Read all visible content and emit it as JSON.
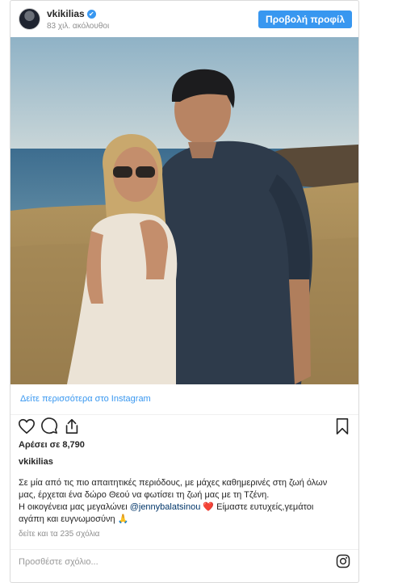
{
  "post": {
    "username": "vkikilias",
    "verified_mark": "✔",
    "followers": "83 χιλ. ακόλουθοι",
    "profile_button": "Προβολή προφίλ",
    "see_more_link": "Δείτε περισσότερα στο Instagram",
    "likes": "Αρέσει σε 8,790",
    "caption_username": "vkikilias",
    "caption_line1": "Σε μία από τις πιο απαιτητικές περιόδους, με μάχες καθημερινές στη ζωή όλων",
    "caption_line2": "μας, έρχεται ένα δώρο Θεού να φωτίσει τη ζωή μας με τη Τζένη.",
    "caption_line3_pre": "Η οικογένεια μας μεγαλώνει ",
    "caption_mention": "@jennybalatsinou",
    "caption_heart": "❤️",
    "caption_line3_post": " Είμαστε ευτυχείς,γεμάτοι",
    "caption_line4": "αγάπη και ευγνωμοσύνη",
    "caption_pray": "🙏",
    "comments": "δείτε και τα 235 σχόλια",
    "comment_placeholder": "Προσθέστε σχόλιο..."
  },
  "icons": {
    "heart": "heart-icon",
    "comment": "comment-icon",
    "share": "share-icon",
    "bookmark": "bookmark-icon",
    "instagram": "instagram-icon"
  },
  "colors": {
    "accent": "#3897f0",
    "text": "#262626",
    "muted": "#8e8e8e"
  }
}
